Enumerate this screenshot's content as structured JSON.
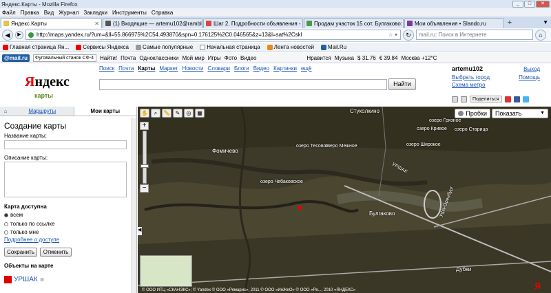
{
  "window": {
    "title": "Яндекс.Карты - Mozilla Firefox"
  },
  "menu": [
    "Файл",
    "Правка",
    "Вид",
    "Журнал",
    "Закладки",
    "Инструменты",
    "Справка"
  ],
  "tabs": [
    {
      "label": "Яндекс.Карты",
      "color": "#e8c24a"
    },
    {
      "label": "(1) Входящие — artemu102@rambler....",
      "color": "#555"
    },
    {
      "label": "Шаг 2. Подробности объявления - ...",
      "color": "#d44"
    },
    {
      "label": "Продам участок 15 сот. Булгаково: ...",
      "color": "#4a9a4a"
    },
    {
      "label": "Мои объявления • Slando.ru",
      "color": "#7a3aa0"
    }
  ],
  "nav": {
    "url": "http://maps.yandex.ru/?um=&ll=55.866975%2C54.493870&spn=0.176125%2C0.046565&z=13&l=sat%2Cskl",
    "search_placeholder": "mail.ru: Поиск в Интернете"
  },
  "bookmarks": [
    "Главная страница Ян...",
    "Сервисы Яндекса",
    "Самые популярные",
    "Начальная страница",
    "Лента новостей",
    "Mail.Ru"
  ],
  "toolbar2": {
    "brand": "@mail.ru",
    "search_value": "Фуговальный станок СФ-4",
    "find": "Найти!",
    "items": [
      "Почта",
      "Одноклассники",
      "Мой мир",
      "Игры",
      "Фото",
      "Видео"
    ],
    "like": "Нравится",
    "music": "Музыка",
    "usd": "31.76",
    "eur": "39.84",
    "weather": "Москва +12°С"
  },
  "yandex": {
    "logo_first": "Я",
    "logo_rest": "ндекс",
    "logo_sub": "карты",
    "nav": [
      "Поиск",
      "Почта",
      "Карты",
      "Маркет",
      "Новости",
      "Словари",
      "Блоги",
      "Видео",
      "Картинки",
      "ещё"
    ],
    "current_nav": "Карты",
    "find_button": "Найти",
    "user": "artemu102",
    "user_links": [
      "Выбрать город",
      "Схема метро"
    ],
    "right_links": [
      "Выход",
      "Помощь"
    ],
    "share": "Поделиться"
  },
  "sidebar": {
    "tabs": [
      "Маршруты",
      "Мои карты"
    ],
    "title": "Создание карты",
    "name_label": "Название карты:",
    "desc_label": "Описание карты:",
    "access_label": "Карта доступна",
    "access_options": [
      "всем",
      "только по ссылке",
      "только мне"
    ],
    "more_link": "Подробнее о доступе",
    "save": "Сохранить",
    "cancel": "Отменить",
    "objects_label": "Объекты на карте",
    "object_name": "УРШАК"
  },
  "map": {
    "probki": "Пробки",
    "show": "Показать",
    "labels": [
      "Стукoлкино",
      "Фомичево",
      "Булгаково",
      "Дубки",
      "озеро Чебаковское",
      "озеро Тесовое",
      "озеро Межное",
      "озеро Широкое",
      "озеро Кривое",
      "озеро Грязное",
      "озеро Старица",
      "УРШАК",
      "Уфа-Оренбург"
    ],
    "copyright": "© ООО ИТЦ «СКАНЭКС»; © Yandex © ООО «Ремарис», 2011 © ООО «ИнЖеО» © ООО «Ре..., 2010 «ЯНДЕКС»",
    "ya": "Я"
  }
}
